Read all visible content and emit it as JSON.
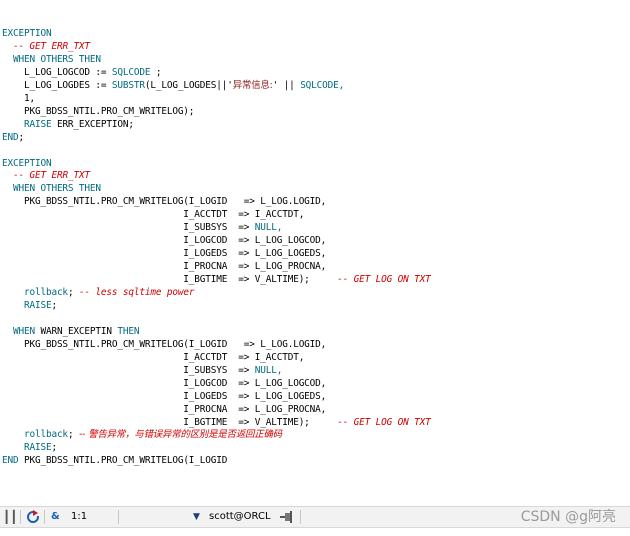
{
  "colors": {
    "keyword": "#006a7f",
    "comment": "#d00000",
    "text": "#000000",
    "string": "#8a1c1c",
    "statusbar_bg": "#f2f2f2"
  },
  "code": [
    [
      {
        "t": "EXCEPTION",
        "c": "kw"
      }
    ],
    [
      {
        "t": "  -- ",
        "c": "cm"
      },
      {
        "t": "GET ERR_TXT",
        "c": "cm"
      }
    ],
    [
      {
        "t": "  WHEN OTHERS THEN",
        "c": "kw"
      }
    ],
    [
      {
        "t": "    L_LOG_LOGCOD := ",
        "c": "tx"
      },
      {
        "t": "SQLCODE",
        "c": "kw"
      },
      {
        "t": " ;",
        "c": "tx"
      }
    ],
    [
      {
        "t": "    L_LOG_LOGDES := ",
        "c": "tx"
      },
      {
        "t": "SUBSTR",
        "c": "kw"
      },
      {
        "t": "(L_LOG_LOGDES||'",
        "c": "tx"
      },
      {
        "t": "异常信息:",
        "c": "st zh"
      },
      {
        "t": "' || ",
        "c": "tx"
      },
      {
        "t": "SQLCODE,",
        "c": "kw"
      }
    ],
    [
      {
        "t": "    1,",
        "c": "tx"
      }
    ],
    [
      {
        "t": "    PKG_BDSS_NTIL.PRO_CM_WRITELOG);",
        "c": "tx"
      }
    ],
    [
      {
        "t": "    RAISE",
        "c": "kw"
      },
      {
        "t": " ERR_EXCEPTION;",
        "c": "tx"
      }
    ],
    [
      {
        "t": "END",
        "c": "kw"
      },
      {
        "t": ";",
        "c": "tx"
      }
    ],
    [],
    [
      {
        "t": "EXCEPTION",
        "c": "kw"
      }
    ],
    [
      {
        "t": "  -- ",
        "c": "cm"
      },
      {
        "t": "GET ERR_TXT",
        "c": "cm"
      }
    ],
    [
      {
        "t": "  WHEN OTHERS THEN",
        "c": "kw"
      }
    ],
    [
      {
        "t": "    PKG_BDSS_NTIL.PRO_CM_WRITELOG(I_LOGID   => L_LOG.LOGID,",
        "c": "tx"
      }
    ],
    [
      {
        "t": "                                 I_ACCTDT  => I_ACCTDT,",
        "c": "tx"
      }
    ],
    [
      {
        "t": "                                 I_SUBSYS  => ",
        "c": "tx"
      },
      {
        "t": "NULL,",
        "c": "kw"
      }
    ],
    [
      {
        "t": "                                 I_LOGCOD  => L_LOG_LOGCOD,",
        "c": "tx"
      }
    ],
    [
      {
        "t": "                                 I_LOGEDS  => L_LOG_LOGEDS,",
        "c": "tx"
      }
    ],
    [
      {
        "t": "                                 I_PROCNA  => L_LOG_PROCNA,",
        "c": "tx"
      }
    ],
    [
      {
        "t": "                                 I_BGTIME  => V_ALTIME);     ",
        "c": "tx"
      },
      {
        "t": "-- GET LOG ON TXT",
        "c": "cm"
      }
    ],
    [
      {
        "t": "    rollback",
        "c": "kw"
      },
      {
        "t": "; ",
        "c": "tx"
      },
      {
        "t": "-- less sqltime power",
        "c": "cm"
      }
    ],
    [
      {
        "t": "    RAISE",
        "c": "kw"
      },
      {
        "t": ";",
        "c": "tx"
      }
    ],
    [],
    [
      {
        "t": "  WHEN ",
        "c": "kw"
      },
      {
        "t": "WARN_EXCEPTIN ",
        "c": "tx"
      },
      {
        "t": "THEN",
        "c": "kw"
      }
    ],
    [
      {
        "t": "    PKG_BDSS_NTIL.PRO_CM_WRITELOG(I_LOGID   => L_LOG.LOGID,",
        "c": "tx"
      }
    ],
    [
      {
        "t": "                                 I_ACCTDT  => I_ACCTDT,",
        "c": "tx"
      }
    ],
    [
      {
        "t": "                                 I_SUBSYS  => ",
        "c": "tx"
      },
      {
        "t": "NULL,",
        "c": "kw"
      }
    ],
    [
      {
        "t": "                                 I_LOGCOD  => L_LOG_LOGCOD,",
        "c": "tx"
      }
    ],
    [
      {
        "t": "                                 I_LOGEDS  => L_LOG_LOGEDS,",
        "c": "tx"
      }
    ],
    [
      {
        "t": "                                 I_PROCNA  => L_LOG_PROCNA,",
        "c": "tx"
      }
    ],
    [
      {
        "t": "                                 I_BGTIME  => V_ALTIME);     ",
        "c": "tx"
      },
      {
        "t": "-- GET LOG ON TXT",
        "c": "cm"
      }
    ],
    [
      {
        "t": "    rollback",
        "c": "kw"
      },
      {
        "t": "; ",
        "c": "tx"
      },
      {
        "t": "-- 警告异常，与错误异常的区别是是否返回正确码",
        "c": "cm zh"
      }
    ],
    [
      {
        "t": "    RAISE",
        "c": "kw"
      },
      {
        "t": ";",
        "c": "tx"
      }
    ],
    [
      {
        "t": "END ",
        "c": "kw"
      },
      {
        "t": "PKG_BDSS_NTIL.PRO_CM_WRITELOG(I_LOGID",
        "c": "tx"
      }
    ]
  ],
  "statusbar": {
    "cursor_position": "1:1",
    "connection": "scott@ORCL",
    "icons": [
      "grid-icon",
      "refresh-icon",
      "ampersand-icon",
      "dropdown-arrow-icon",
      "pin-icon"
    ]
  },
  "watermark": "CSDN @g阿亮"
}
